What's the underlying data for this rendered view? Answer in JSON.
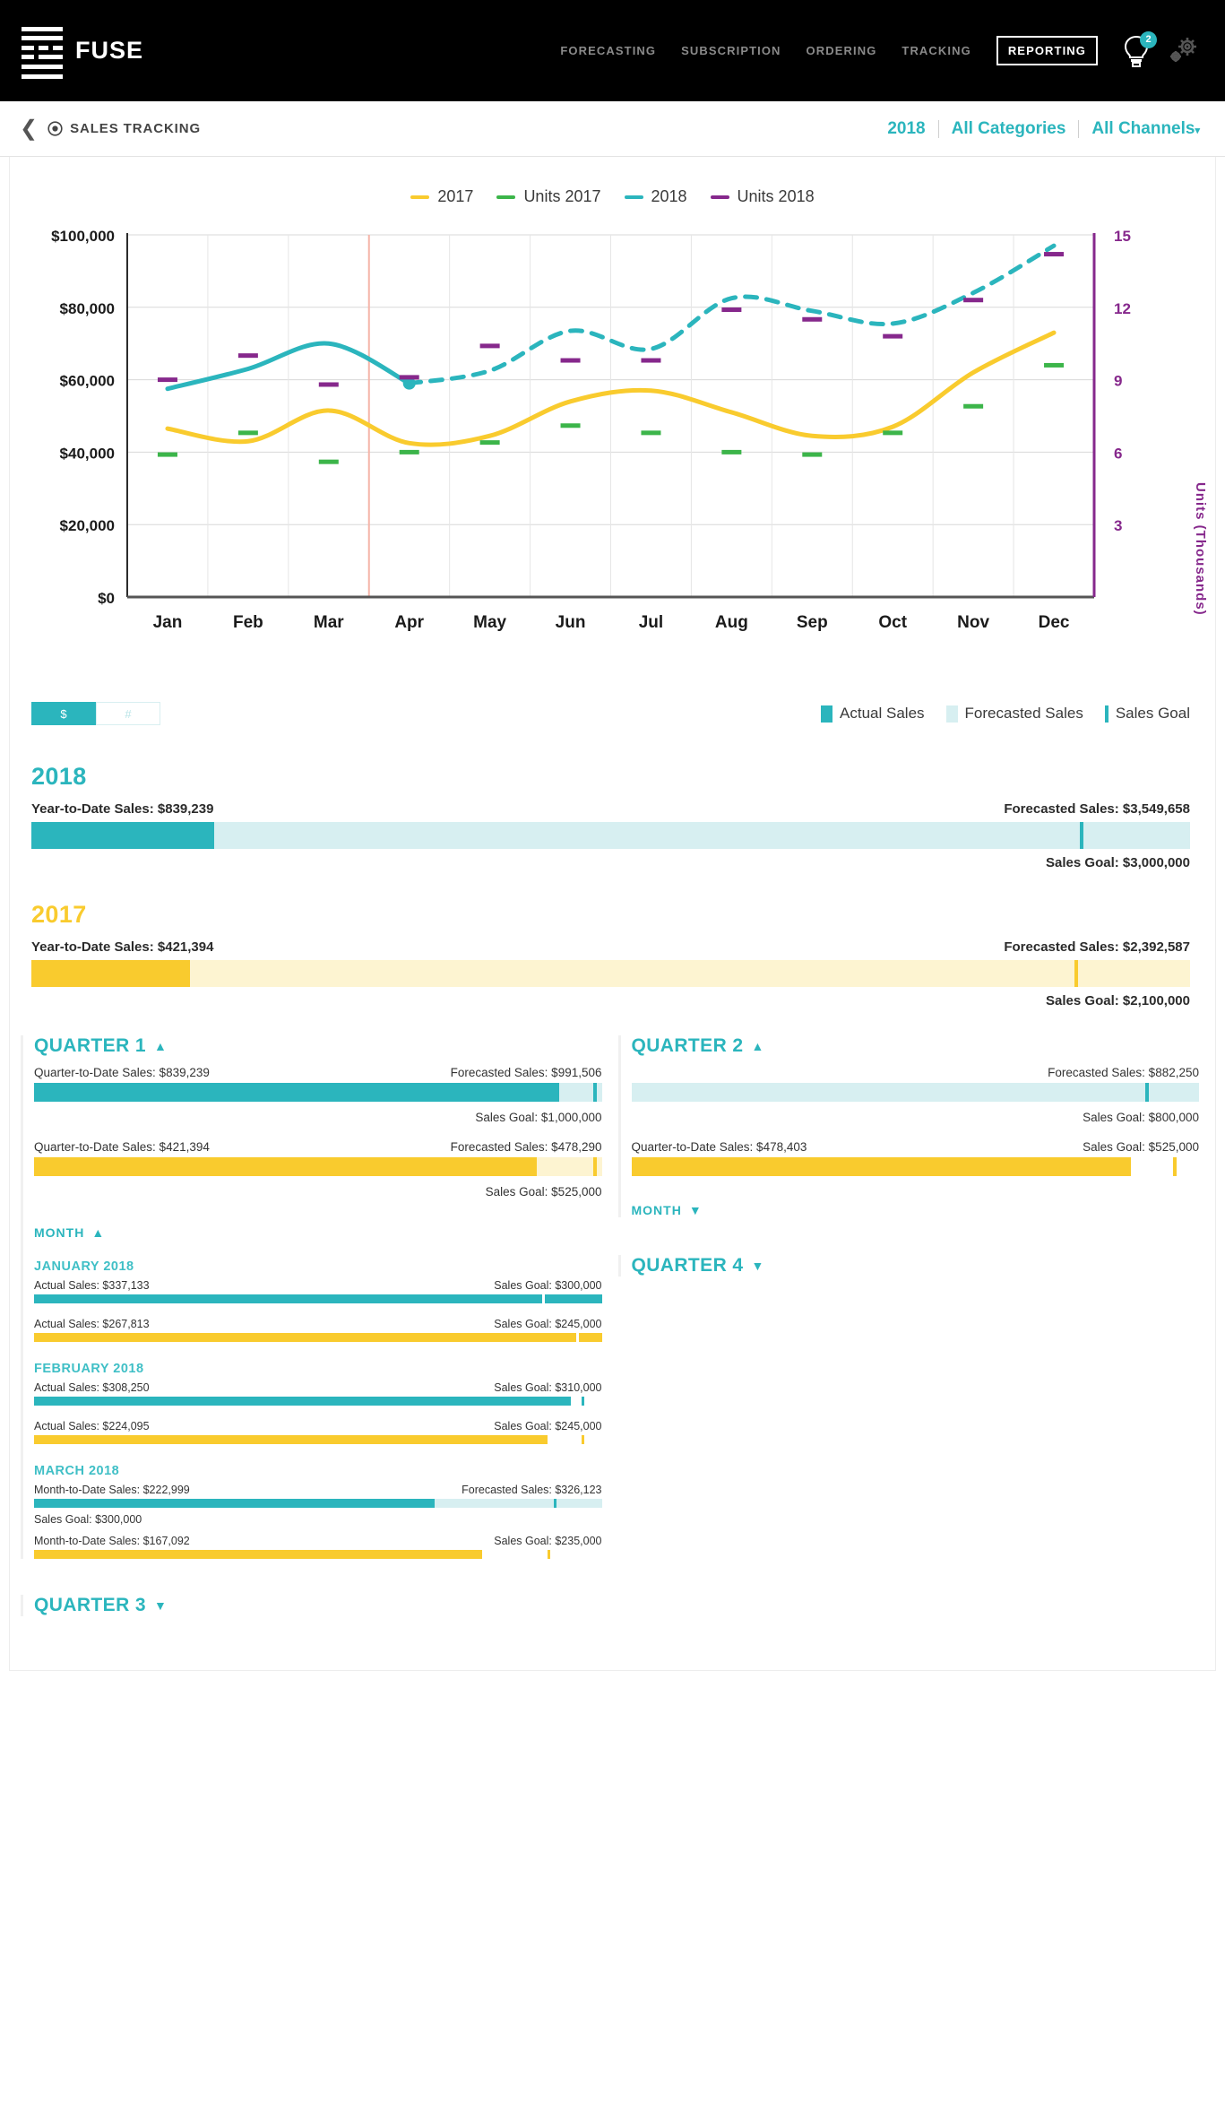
{
  "header": {
    "brand": "FUSE",
    "logo_icon": "fuse-bars-logo",
    "nav": [
      {
        "label": "FORECASTING",
        "active": false
      },
      {
        "label": "SUBSCRIPTION",
        "active": false
      },
      {
        "label": "ORDERING",
        "active": false
      },
      {
        "label": "TRACKING",
        "active": false
      },
      {
        "label": "REPORTING",
        "active": true
      }
    ],
    "bulb_icon": "lightbulb-icon",
    "bulb_badge": "2",
    "gears_icon": "gears-icon"
  },
  "subheader": {
    "back_icon": "back-chevron-icon",
    "target_icon": "target-icon",
    "title": "SALES TRACKING",
    "filters": [
      {
        "label": "2018"
      },
      {
        "label": "All Categories"
      },
      {
        "label": "All Channels",
        "caret": "▾"
      }
    ]
  },
  "chart_legend": [
    {
      "label": "2017",
      "color": "#f9cb2e"
    },
    {
      "label": "Units 2017",
      "color": "#3cb54a"
    },
    {
      "label": "2018",
      "color": "#2bb5bd"
    },
    {
      "label": "Units 2018",
      "color": "#86288c"
    }
  ],
  "chart_data": {
    "type": "line",
    "title": "",
    "xlabel": "",
    "ylabel": "",
    "y2label": "Units (Thousands)",
    "categories": [
      "Jan",
      "Feb",
      "Mar",
      "Apr",
      "May",
      "Jun",
      "Jul",
      "Aug",
      "Sep",
      "Oct",
      "Nov",
      "Dec"
    ],
    "ylim": [
      0,
      100000
    ],
    "yticks": [
      "$0",
      "$20,000",
      "$40,000",
      "$60,000",
      "$80,000",
      "$100,000"
    ],
    "y2lim": [
      0,
      15
    ],
    "y2ticks": [
      "3",
      "6",
      "9",
      "12",
      "15"
    ],
    "grid": true,
    "legend_position": "top-right",
    "today_marker_month": "Apr",
    "series": [
      {
        "name": "2017",
        "color": "#f9cb2e",
        "style": "solid",
        "axis": "left",
        "values": [
          46500,
          43000,
          51500,
          42500,
          44500,
          54000,
          57000,
          51000,
          44500,
          47000,
          62000,
          73000
        ]
      },
      {
        "name": "2018",
        "color": "#2bb5bd",
        "style": "solid-then-dashed",
        "axis": "left",
        "actual_through": "Apr",
        "values": [
          57500,
          63000,
          70000,
          59000,
          62500,
          73500,
          68500,
          82500,
          79000,
          75500,
          84000,
          97000
        ]
      },
      {
        "name": "Units 2017",
        "color": "#3cb54a",
        "style": "marker",
        "axis": "right",
        "values": [
          5.9,
          6.8,
          5.6,
          6.0,
          6.4,
          7.1,
          6.8,
          6.0,
          5.9,
          6.8,
          7.9,
          9.6
        ]
      },
      {
        "name": "Units 2018",
        "color": "#86288c",
        "style": "marker",
        "axis": "right",
        "values": [
          9.0,
          10.0,
          8.8,
          9.1,
          10.4,
          9.8,
          9.8,
          11.9,
          11.5,
          10.8,
          12.3,
          14.2
        ]
      }
    ]
  },
  "chart_toggles": [
    {
      "label": "$",
      "active": true
    },
    {
      "label": "#",
      "active": false
    }
  ],
  "chart_foot_legend": [
    {
      "label": "Actual Sales",
      "color": "#2bb5bd",
      "kind": "swatch"
    },
    {
      "label": "Forecasted Sales",
      "color": "#d7eff1",
      "kind": "swatch"
    },
    {
      "label": "Sales Goal",
      "color": "#2bb5bd",
      "kind": "bar"
    }
  ],
  "year_summaries": [
    {
      "year": "2018",
      "color": "#2bb5bd",
      "fore_color": "#d7eff1",
      "ytd_label": "Year-to-Date Sales: $839,239",
      "fore_label": "Forecasted Sales: $3,549,658",
      "goal_label": "Sales Goal: $3,000,000",
      "actual_pct": 24,
      "fore_pct": 100,
      "goal_pct": 90.5
    },
    {
      "year": "2017",
      "color": "#f9cb2e",
      "fore_color": "#fdf4d1",
      "ytd_label": "Year-to-Date Sales: $421,394",
      "fore_label": "Forecasted Sales: $2,392,587",
      "goal_label": "Sales Goal: $2,100,000",
      "actual_pct": 21,
      "fore_pct": 100,
      "goal_pct": 90.0
    }
  ],
  "quarters": {
    "q1": {
      "title": "QUARTER 1",
      "caret": "▲",
      "expanded": true,
      "bars": [
        {
          "left_label": "Quarter-to-Date Sales: $839,239",
          "right_label": "Forecasted Sales: $991,506",
          "goal_label": "Sales Goal: $1,000,000",
          "color": "#2bb5bd",
          "fore_color": "#d7eff1",
          "actual_pct": 92.5,
          "fore_pct": 98.5,
          "goal_pct": 99.2
        },
        {
          "left_label": "Quarter-to-Date Sales: $421,394",
          "right_label": "Forecasted Sales: $478,290",
          "goal_label": "Sales Goal: $525,000",
          "color": "#f9cb2e",
          "fore_color": "#fdf4d1",
          "actual_pct": 88.5,
          "fore_pct": 97.5,
          "goal_pct": 99.0
        }
      ],
      "month_toggle": {
        "label": "MONTH",
        "caret": "▲",
        "expanded": true
      },
      "months": [
        {
          "name": "JANUARY 2018",
          "rows": [
            {
              "left_label": "Actual Sales: $337,133",
              "right_label": "Sales Goal: $300,000",
              "color": "#2bb5bd",
              "fore_color": "#d7eff1",
              "actual_pct": 100,
              "fore_pct": 0,
              "goal_pct": 89.5
            },
            {
              "left_label": "Actual Sales: $267,813",
              "right_label": "Sales Goal: $245,000",
              "color": "#f9cb2e",
              "fore_color": "#fdf4d1",
              "actual_pct": 100,
              "fore_pct": 0,
              "goal_pct": 95.5
            }
          ]
        },
        {
          "name": "FEBRUARY 2018",
          "rows": [
            {
              "left_label": "Actual Sales: $308,250",
              "right_label": "Sales Goal: $310,000",
              "color": "#2bb5bd",
              "fore_color": "#d7eff1",
              "actual_pct": 94.5,
              "fore_pct": 0,
              "goal_pct": 96.5
            },
            {
              "left_label": "Actual Sales: $224,095",
              "right_label": "Sales Goal: $245,000",
              "color": "#f9cb2e",
              "fore_color": "#fdf4d1",
              "actual_pct": 90.5,
              "fore_pct": 0,
              "goal_pct": 96.5
            }
          ]
        },
        {
          "name": "MARCH 2018",
          "rows": [
            {
              "left_label": "Month-to-Date Sales: $222,999",
              "right_label": "Forecasted Sales: $326,123",
              "goal_label": "Sales Goal: $300,000",
              "color": "#2bb5bd",
              "fore_color": "#d7eff1",
              "actual_pct": 70.5,
              "fore_pct": 100,
              "goal_pct": 91.5
            },
            {
              "left_label": "Month-to-Date Sales: $167,092",
              "right_label": "Sales Goal: $235,000",
              "color": "#f9cb2e",
              "fore_color": "#fdf4d1",
              "actual_pct": 79.0,
              "fore_pct": 0,
              "goal_pct": 90.5
            }
          ]
        }
      ]
    },
    "q2": {
      "title": "QUARTER 2",
      "caret": "▲",
      "expanded": true,
      "bars": [
        {
          "left_label": "",
          "right_label": "Forecasted Sales: $882,250",
          "goal_label": "Sales Goal: $800,000",
          "color": "#2bb5bd",
          "fore_color": "#d7eff1",
          "actual_pct": 0,
          "fore_pct": 100,
          "goal_pct": 90.5
        },
        {
          "left_label": "Quarter-to-Date Sales: $478,403",
          "right_label": "Sales Goal: $525,000",
          "color": "#f9cb2e",
          "fore_color": "#fdf4d1",
          "actual_pct": 89.0,
          "fore_pct": 0,
          "goal_pct": 95.5
        }
      ],
      "month_toggle": {
        "label": "MONTH",
        "caret": "▼",
        "expanded": false
      }
    },
    "q3": {
      "title": "QUARTER 3",
      "caret": "▼",
      "expanded": false
    },
    "q4": {
      "title": "QUARTER 4",
      "caret": "▼",
      "expanded": false
    }
  }
}
